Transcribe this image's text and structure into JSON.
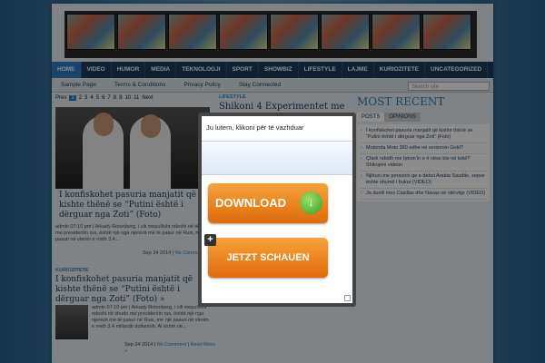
{
  "nav": {
    "items": [
      "HOME",
      "VIDEO",
      "HUMOR",
      "MEDIA",
      "TEKNOLOGJI",
      "SPORT",
      "SHOWBIZ",
      "LIFESTYLE",
      "LAJME",
      "KURIOZITETE",
      "UNCATEGORIZED"
    ]
  },
  "subnav": {
    "items": [
      "Sample Page",
      "Terms & Conditions",
      "Privacy Policy",
      "Stay Connected"
    ],
    "search_placeholder": "Search site"
  },
  "pager": {
    "prev": "Prev",
    "pages": [
      "1",
      "2",
      "3",
      "4",
      "5",
      "6",
      "7",
      "8",
      "9",
      "10",
      "11"
    ],
    "next": "Next"
  },
  "post1": {
    "title": "I konfiskohet pasuria manjatit që kishte thënë se “Putini është i dërguar nga Zoti” (Foto)",
    "meta": "admin 07:10 pm | Arkady Rotenberg, i cili mepullisht ndeshi në shudo me presidentin rus, është një nga njerëzit më të pasur në Rusi, me një pasuri në vlerën e rreth 3.4...",
    "date": "Sep 24 2014",
    "comment": "No Comment",
    "more": "Read More »"
  },
  "post2": {
    "category": "KURIOZITETE",
    "title": "I konfiskohet pasuria manjatit që kishte thënë se “Putini është i dërguar nga Zoti” (Foto) »",
    "meta": "admin 07:10 pm | Arkady Rotenberg, i cili mepullisht ndeshi në shudo me presidentin rus, është një nga njerëzit më të pasur në Rusi, me një pasuri në vlerën e rreth 3.4 miliardë dollarësh. Ai është në...",
    "date": "Sep 24 2014",
    "comment": "No Comment",
    "more": "Read More »"
  },
  "mid_post": {
    "category": "LIFESTYLE",
    "title": "Shikoni 4 Experimentet me"
  },
  "sidebar": {
    "heading": "MOST RECENT",
    "tabs": [
      "POSTS",
      "OPINIONS"
    ],
    "items": [
      "I konfiskohet pasuria manjatit që kishte thënë se “Putini është i dërguar nga Zoti” (Foto)",
      "Motorola Moto 360 edhe në versionin Gold?",
      "Çfarë ndodh me Iphon’in e ri nëse bie në tokë? Shikojeni videon",
      "Njihuni me personin qe e deboi Arabia Saudite, sepse ështe shumë i bukur (VIDEO)",
      "Ja duelli mes Casillas dhe Navas në stërvitje (VIDEO)"
    ]
  },
  "popup": {
    "title": "Ju lutem, klikoni për të vazhduar",
    "download_label": "DOWNLOAD",
    "download_icon": "download-arrow-icon",
    "jetzt_label": "JETZT SCHAUEN"
  },
  "colors": {
    "accent": "#2f7fc0",
    "nav_bg": "#1c3c5a",
    "button_orange": "#f07f1a"
  }
}
